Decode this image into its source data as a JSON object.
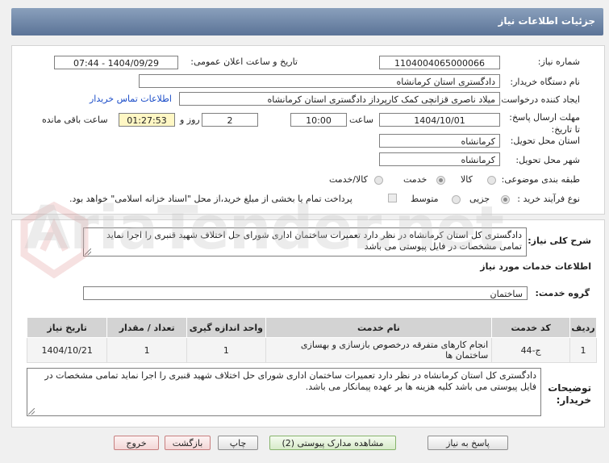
{
  "header": {
    "title": "جزئیات اطلاعات نیاز"
  },
  "form": {
    "need_number_label": "شماره نیاز:",
    "need_number": "1104004065000066",
    "announce_label": "تاریخ و ساعت اعلان عمومی:",
    "announce_value": "1404/09/29 - 07:44",
    "buyer_label": "نام دستگاه خریدار:",
    "buyer_value": "دادگستری استان کرمانشاه",
    "creator_label": "ایجاد کننده درخواست:",
    "creator_value": "میلاد ناصری قزانچی کمک کارپرداز دادگستری استان کرمانشاه",
    "contact_link": "اطلاعات تماس خریدار",
    "deadline_label": "مهلت ارسال پاسخ: تا تاریخ:",
    "deadline_date": "1404/10/01",
    "time_label": "ساعت",
    "deadline_time": "10:00",
    "days_value": "2",
    "days_label": "روز و",
    "remaining_time": "01:27:53",
    "remaining_label": "ساعت باقی مانده",
    "province_label": "استان محل تحویل:",
    "province_value": "کرمانشاه",
    "city_label": "شهر محل تحویل:",
    "city_value": "کرمانشاه",
    "category_label": "طبقه بندی موضوعی:",
    "category_options": [
      "کالا",
      "خدمت",
      "کالا/خدمت"
    ],
    "category_selected": "خدمت",
    "process_label": "نوع فرآیند خرید :",
    "process_options": [
      "جزیی",
      "متوسط"
    ],
    "process_selected": "جزیی",
    "payment_text": "پرداخت تمام یا بخشی از مبلغ خرید،از محل \"اسناد خزانه اسلامی\" خواهد بود."
  },
  "summary": {
    "label": "شرح کلی نیاز:",
    "text": "دادگستری کل استان کرمانشاه در نظر دارد  تعمیرات ساختمان اداری شورای حل اختلاف شهید قنبری را اجرا نماید  تمامی مشخصات در فایل پیوستی می باشد"
  },
  "services": {
    "section_title": "اطلاعات خدمات مورد نیاز",
    "group_label": "گروه خدمت:",
    "group_value": "ساختمان",
    "table_headers": [
      "ردیف",
      "کد خدمت",
      "نام خدمت",
      "واحد اندازه گیری",
      "تعداد / مقدار",
      "تاریخ نیاز"
    ],
    "rows": [
      {
        "index": "1",
        "code": "ج-44",
        "name": "انجام کارهای متفرقه درخصوص بازسازی و بهسازی ساختمان ها",
        "unit": "1",
        "qty": "1",
        "date": "1404/10/21"
      }
    ]
  },
  "buyer_notes": {
    "label": "توضیحات خریدار:",
    "text": "دادگستری کل استان کرمانشاه در نظر دارد  تعمیرات ساختمان اداری شورای حل اختلاف شهید قنبری را اجرا نماید  تمامی مشخصات در فایل پیوستی می باشد کلیه هزینه ها بر عهده پیمانکار می باشد."
  },
  "buttons": {
    "reply": "پاسخ به نیاز",
    "attachments": "مشاهده مدارک پیوستی (2)",
    "print": "چاپ",
    "back": "بازگشت",
    "exit": "خروج"
  },
  "watermark": "AriaTender.net",
  "colors": {
    "header_bg": "#6f86a8",
    "link": "#1a4cc8"
  }
}
